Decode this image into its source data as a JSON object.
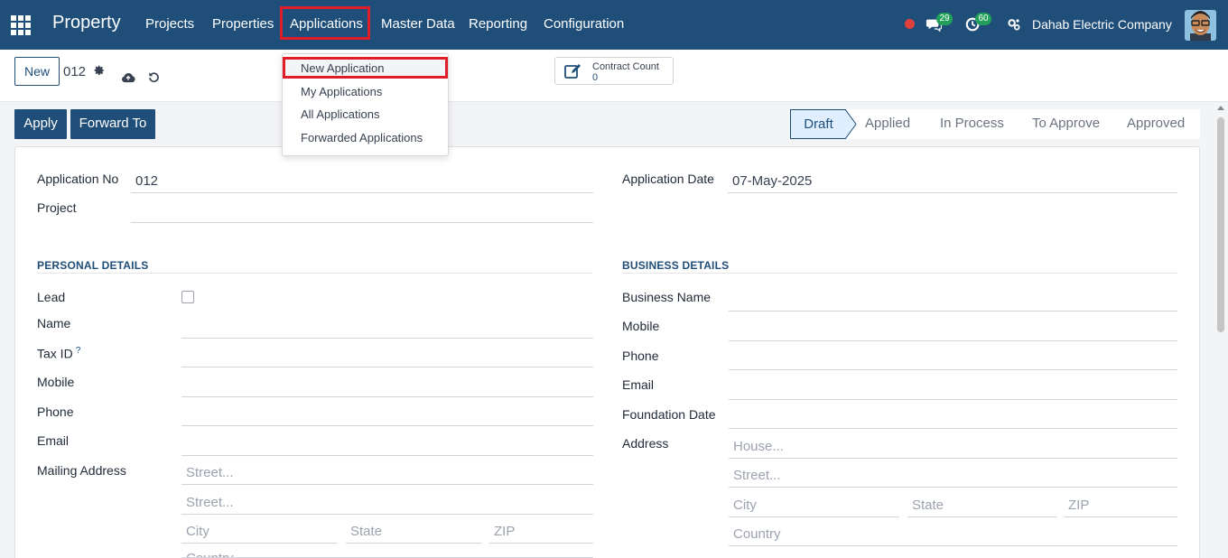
{
  "navbar": {
    "brand": "Property",
    "menu": [
      "Projects",
      "Properties",
      "Applications",
      "Master Data",
      "Reporting",
      "Configuration"
    ],
    "messages_count": "29",
    "activities_count": "60",
    "company": "Dahab Electric Company",
    "highlight_color": "#e11d2a",
    "bar_color": "#1f4e79"
  },
  "applications_menu": {
    "items": [
      "New Application",
      "My Applications",
      "All Applications",
      "Forwarded Applications"
    ]
  },
  "control": {
    "new_label": "New",
    "record_id": "012",
    "contract_count_label": "Contract Count",
    "contract_count_value": "0"
  },
  "actions": {
    "apply": "Apply",
    "forward": "Forward To"
  },
  "status": {
    "current": "Draft",
    "steps": [
      "Applied",
      "In Process",
      "To Approve",
      "Approved"
    ]
  },
  "form": {
    "application_no_label": "Application No",
    "application_no": "012",
    "application_date_label": "Application Date",
    "application_date": "07-May-2025",
    "project_label": "Project",
    "project": ""
  },
  "personal": {
    "title": "PERSONAL DETAILS",
    "lead_label": "Lead",
    "name_label": "Name",
    "tax_label": "Tax ID",
    "tax_help": "?",
    "mobile_label": "Mobile",
    "phone_label": "Phone",
    "email_label": "Email",
    "mailing_label": "Mailing Address",
    "street_ph": "Street...",
    "street2_ph": "Street...",
    "city_ph": "City",
    "state_ph": "State",
    "zip_ph": "ZIP",
    "country_ph": "Country"
  },
  "business": {
    "title": "BUSINESS DETAILS",
    "name_label": "Business Name",
    "mobile_label": "Mobile",
    "phone_label": "Phone",
    "email_label": "Email",
    "foundation_label": "Foundation Date",
    "address_label": "Address",
    "house_ph": "House...",
    "street_ph": "Street...",
    "city_ph": "City",
    "state_ph": "State",
    "zip_ph": "ZIP",
    "country_ph": "Country"
  }
}
